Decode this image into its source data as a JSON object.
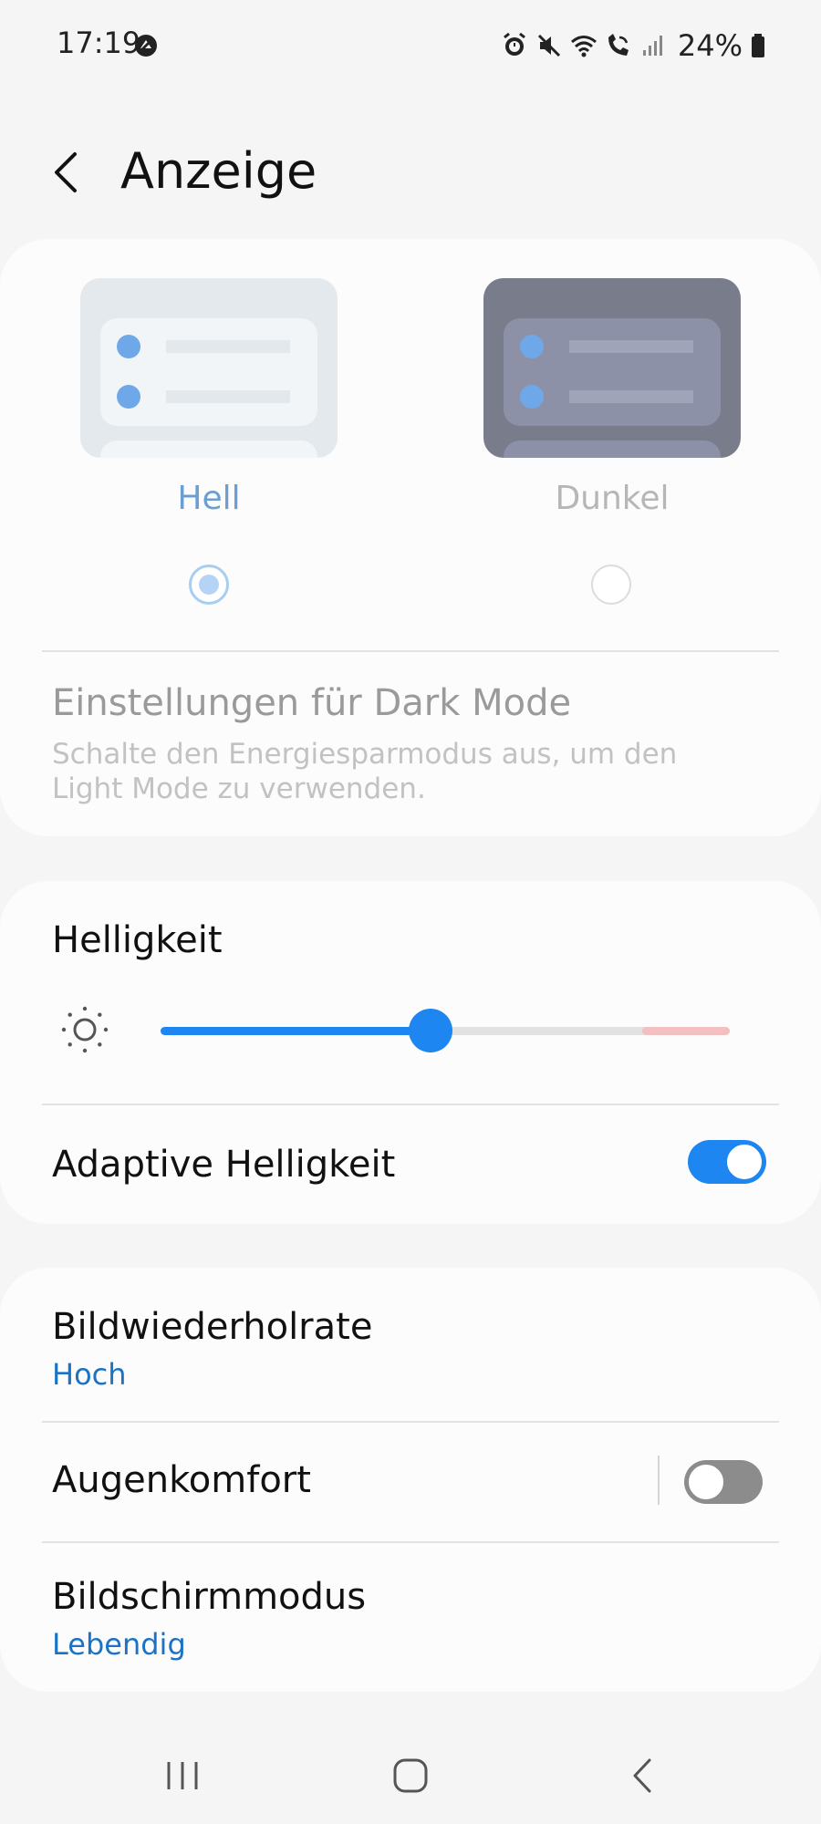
{
  "status_bar": {
    "time": "17:19",
    "battery": "24%",
    "icons": [
      "notification-blocked-icon",
      "alarm-icon",
      "mute-icon",
      "wifi-icon",
      "wifi-calling-icon",
      "signal-icon",
      "battery-icon"
    ]
  },
  "header": {
    "title": "Anzeige",
    "back_icon": "back-arrow-icon"
  },
  "theme": {
    "options": [
      {
        "label": "Hell",
        "selected": true
      },
      {
        "label": "Dunkel",
        "selected": false
      }
    ],
    "dark_mode_settings": {
      "title": "Einstellungen für Dark Mode",
      "subtitle": "Schalte den Energiesparmodus aus, um den Light Mode zu verwenden."
    }
  },
  "brightness": {
    "title": "Helligkeit",
    "level": 0.475,
    "adaptive_label": "Adaptive Helligkeit",
    "adaptive_enabled": true
  },
  "settings": {
    "refresh_rate": {
      "title": "Bildwiederholrate",
      "value": "Hoch"
    },
    "eye_comfort": {
      "title": "Augenkomfort",
      "enabled": false
    },
    "screen_mode": {
      "title": "Bildschirmmodus",
      "value": "Lebendig"
    }
  },
  "nav_bar": {
    "buttons": [
      "recent-apps-icon",
      "home-icon",
      "back-icon"
    ]
  },
  "colors": {
    "accent": "#1e86f0",
    "link": "#1a73c6",
    "background": "#f5f5f5",
    "card": "#fcfcfc"
  }
}
